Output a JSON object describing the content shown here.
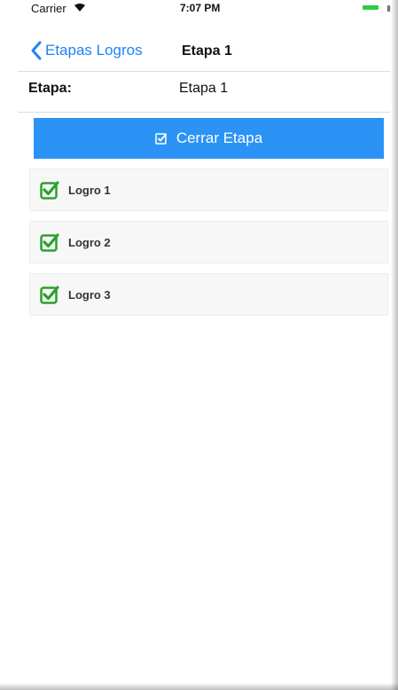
{
  "status_bar": {
    "carrier": "Carrier",
    "time": "7:07 PM"
  },
  "nav": {
    "back_label": "Etapas Logros",
    "title": "Etapa 1"
  },
  "etapa": {
    "label": "Etapa:",
    "value": "Etapa 1"
  },
  "close_button": {
    "label": "Cerrar Etapa"
  },
  "logros": [
    {
      "label": "Logro 1",
      "checked": true
    },
    {
      "label": "Logro 2",
      "checked": true
    },
    {
      "label": "Logro 3",
      "checked": true
    }
  ],
  "colors": {
    "accent": "#1e83f7",
    "button": "#2b93f5",
    "check": "#2aa12a"
  },
  "icons": {
    "back": "chevron-left-icon",
    "button": "check-square-icon",
    "logro": "check-square-icon",
    "wifi": "wifi-icon",
    "battery": "battery-icon"
  }
}
